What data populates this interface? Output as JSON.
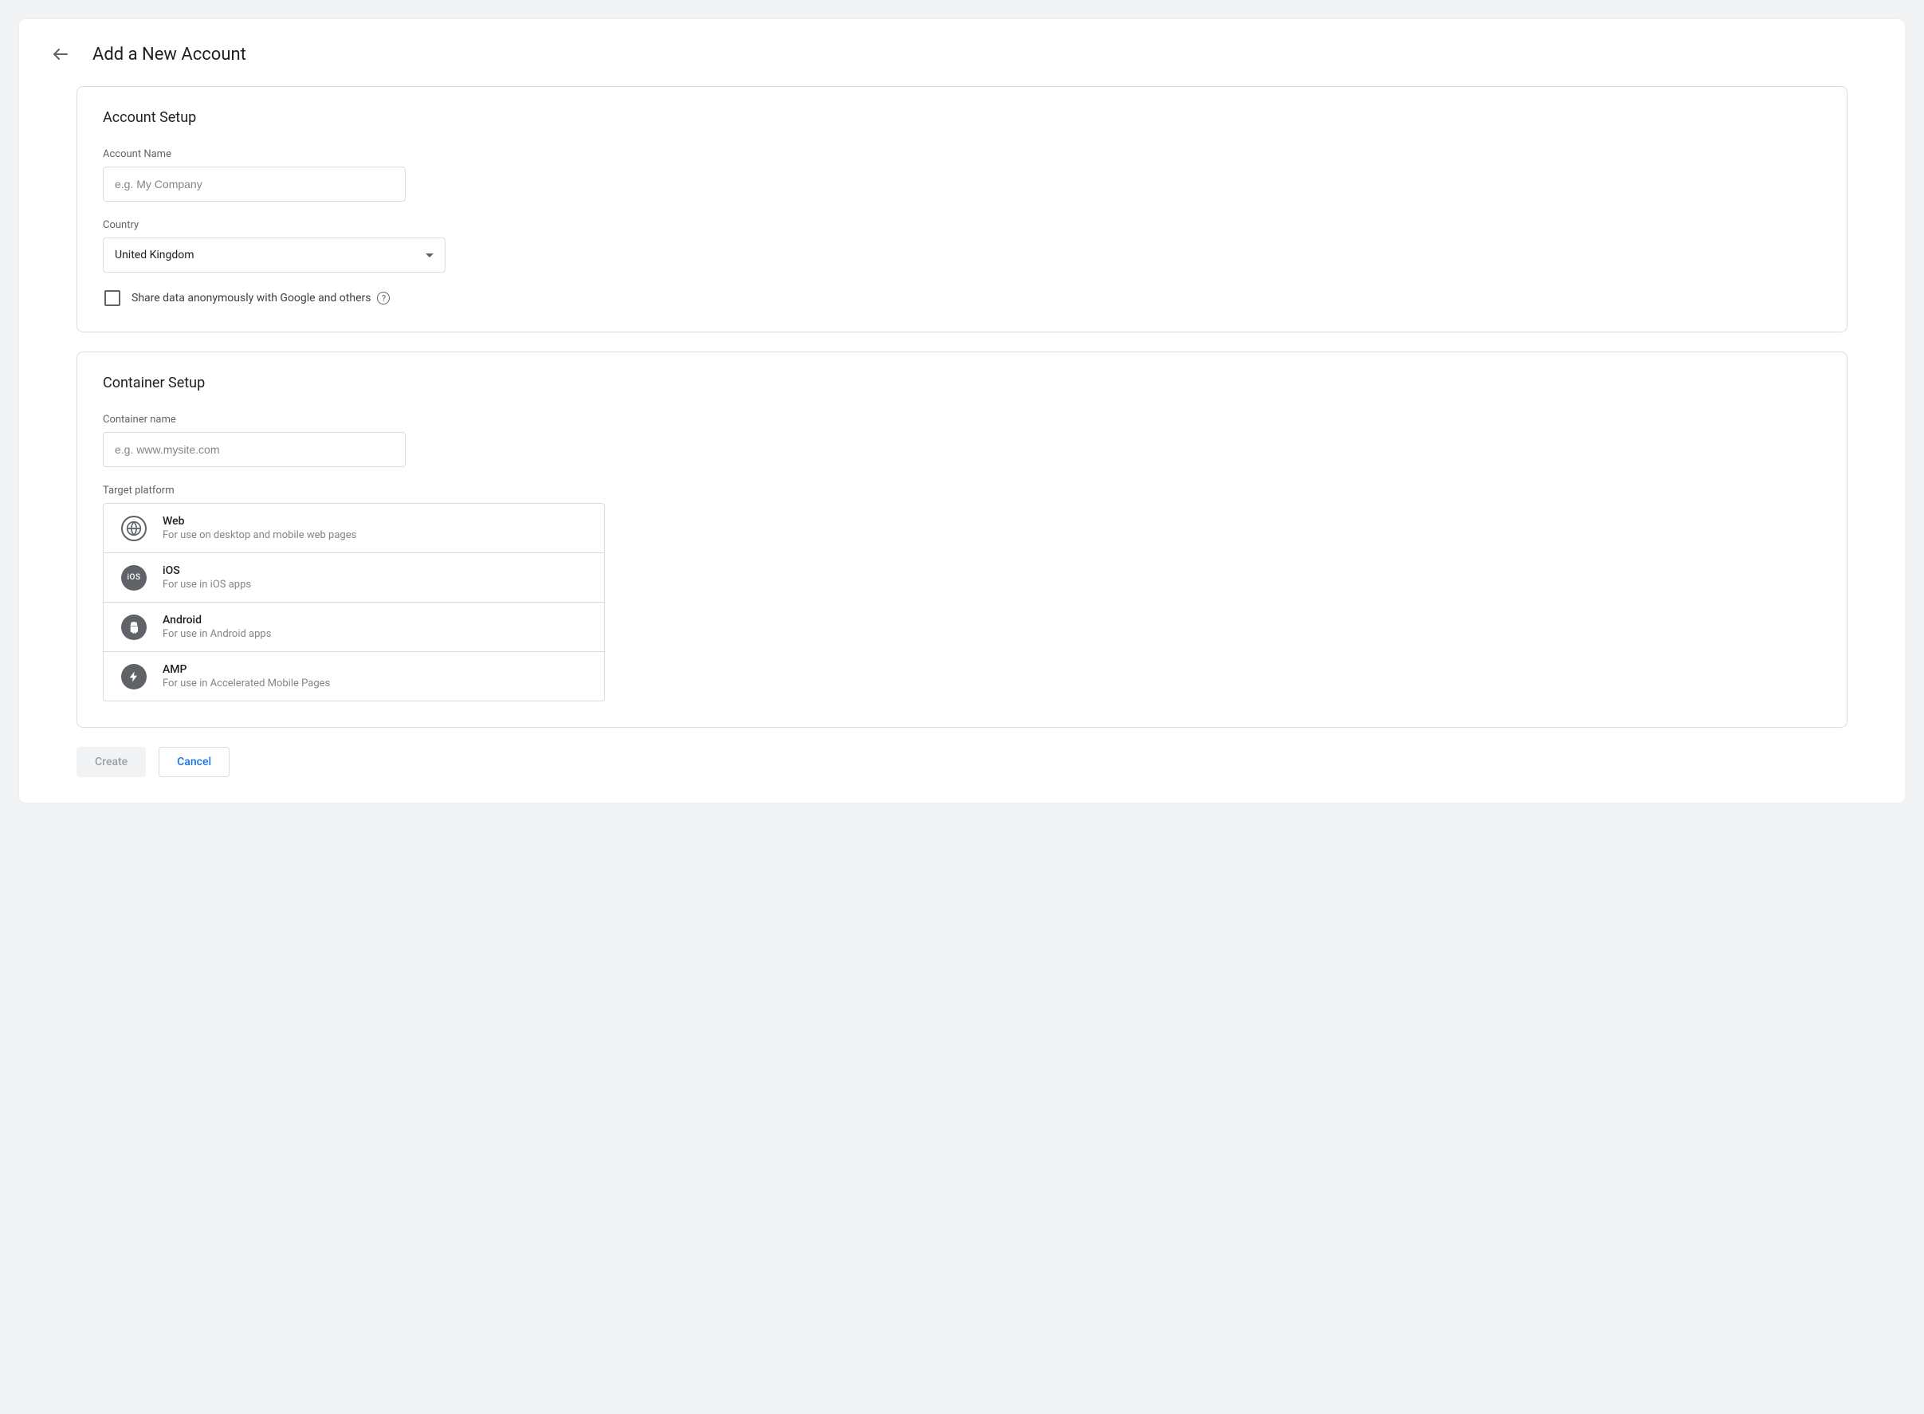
{
  "header": {
    "title": "Add a New Account"
  },
  "account": {
    "section_title": "Account Setup",
    "name_label": "Account Name",
    "name_placeholder": "e.g. My Company",
    "name_value": "",
    "country_label": "Country",
    "country_selected": "United Kingdom",
    "share_label": "Share data anonymously with Google and others",
    "share_checked": false
  },
  "container": {
    "section_title": "Container Setup",
    "name_label": "Container name",
    "name_placeholder": "e.g. www.mysite.com",
    "name_value": "",
    "platform_label": "Target platform",
    "platforms": [
      {
        "icon": "globe-icon",
        "title": "Web",
        "subtitle": "For use on desktop and mobile web pages"
      },
      {
        "icon": "ios-icon",
        "title": "iOS",
        "subtitle": "For use in iOS apps"
      },
      {
        "icon": "android-icon",
        "title": "Android",
        "subtitle": "For use in Android apps"
      },
      {
        "icon": "amp-icon",
        "title": "AMP",
        "subtitle": "For use in Accelerated Mobile Pages"
      }
    ]
  },
  "buttons": {
    "create": "Create",
    "cancel": "Cancel"
  }
}
